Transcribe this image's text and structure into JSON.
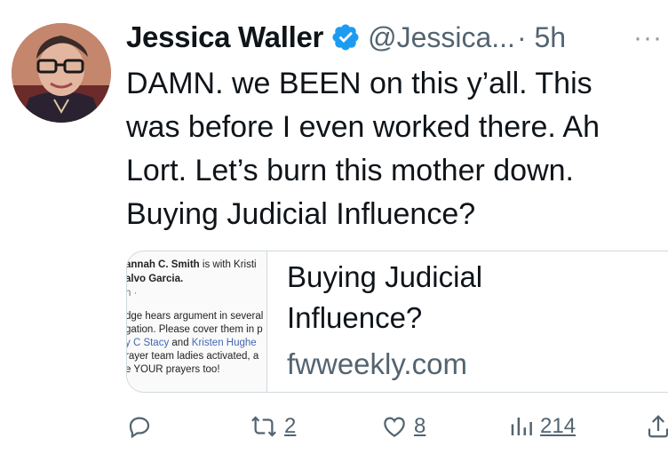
{
  "tweet": {
    "author_name": "Jessica Waller",
    "handle": "@Jessica...",
    "time": "· 5h",
    "more": "···",
    "text_lines": [
      "DAMN. we BEEN on this y’all. This",
      "was before I even worked there. Ah",
      "Lort. Let’s burn this mother down.",
      "Buying Judicial Influence?"
    ]
  },
  "card": {
    "thumbnail_text": {
      "line1_name": "annah C. Smith",
      "line1_rest": " is with Kristi",
      "line2": "alvo Garcia.",
      "line3": "h · ",
      "line4": "dge hears argument in several",
      "line5": "gation. Please cover them in p",
      "line6_a": "y C Stacy",
      "line6_b": " and ",
      "line6_c": "Kristen Hughe",
      "line7": "rayer team ladies activated, a",
      "line8": "e YOUR prayers too!"
    },
    "title_lines": [
      "Buying Judicial",
      "Influence?"
    ],
    "domain": "fwweekly.com"
  },
  "actions": {
    "reply_count": "",
    "retweet_count": "2",
    "like_count": "8",
    "views_count": "214"
  },
  "colors": {
    "verified": "#1d9bf0",
    "muted": "#536471",
    "border": "#cfd9de"
  }
}
